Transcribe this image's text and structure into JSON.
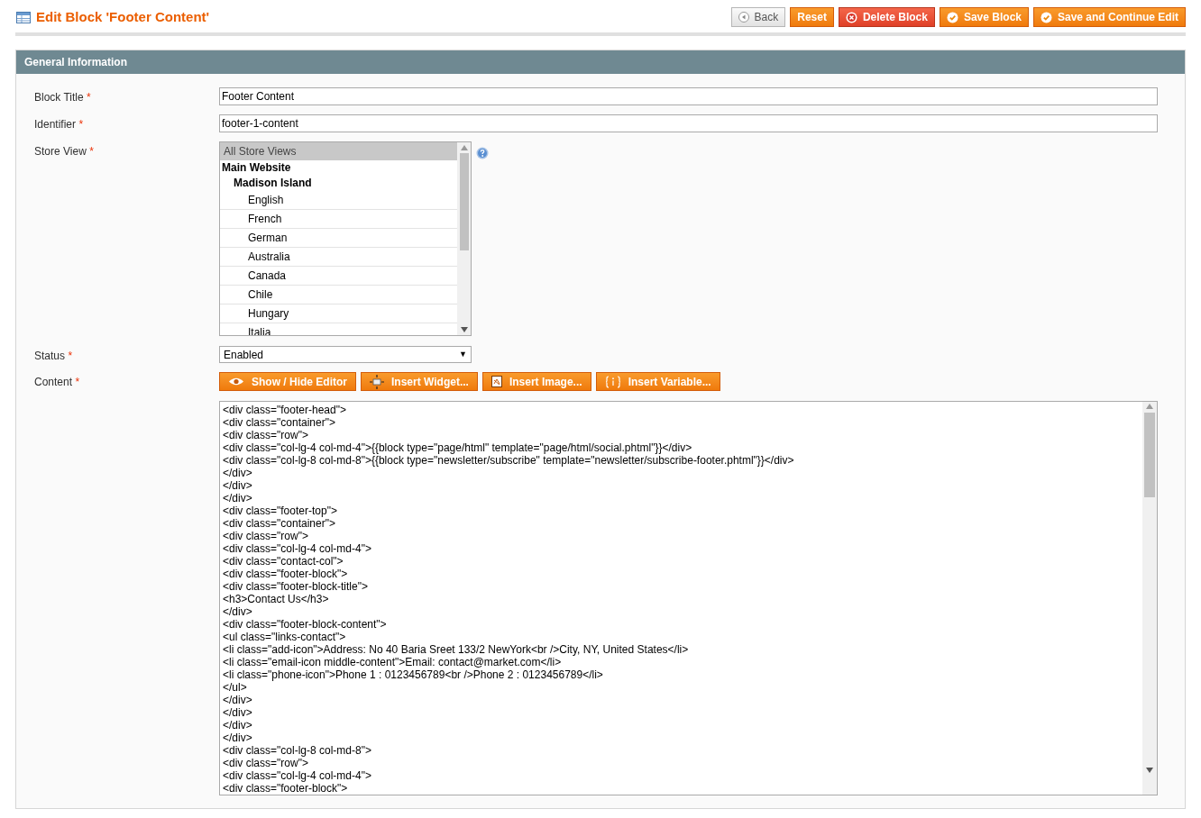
{
  "page_title": "Edit Block 'Footer Content'",
  "header_buttons": [
    {
      "label": "Back",
      "kind": "back"
    },
    {
      "label": "Reset",
      "kind": "plain"
    },
    {
      "label": "Delete Block",
      "kind": "delete"
    },
    {
      "label": "Save Block",
      "kind": "save"
    },
    {
      "label": "Save and Continue Edit",
      "kind": "save"
    }
  ],
  "section_title": "General Information",
  "required_mark": "*",
  "block_title": {
    "label": "Block Title",
    "value": "Footer Content"
  },
  "identifier": {
    "label": "Identifier",
    "value": "footer-1-content"
  },
  "store_view": {
    "label": "Store View",
    "options": [
      {
        "label": "All Store Views",
        "selected": true
      },
      {
        "label": "Main Website",
        "children": [
          {
            "label": "Madison Island",
            "children": [
              {
                "label": "English",
                "selected": false
              },
              {
                "label": "French",
                "selected": false
              },
              {
                "label": "German",
                "selected": false
              },
              {
                "label": "Australia",
                "selected": false
              },
              {
                "label": "Canada",
                "selected": false
              },
              {
                "label": "Chile",
                "selected": false
              },
              {
                "label": "Hungary",
                "selected": false
              },
              {
                "label": "Italia",
                "selected": false
              }
            ]
          }
        ]
      }
    ]
  },
  "status": {
    "label": "Status",
    "value": "Enabled",
    "caret": "▼"
  },
  "content": {
    "label": "Content",
    "buttons": [
      {
        "label": "Show / Hide Editor",
        "kind": "eye"
      },
      {
        "label": "Insert Widget...",
        "kind": "widget"
      },
      {
        "label": "Insert Image...",
        "kind": "image"
      },
      {
        "label": "Insert Variable...",
        "kind": "variable"
      }
    ],
    "lines": [
      "<div class=\"footer-head\">",
      "<div class=\"container\">",
      "<div class=\"row\">",
      "<div class=\"col-lg-4 col-md-4\">{{block type=\"page/html\" template=\"page/html/social.phtml\"}}</div>",
      "<div class=\"col-lg-8 col-md-8\">{{block type=\"newsletter/subscribe\" template=\"newsletter/subscribe-footer.phtml\"}}</div>",
      "</div>",
      "</div>",
      "</div>",
      "<div class=\"footer-top\">",
      "<div class=\"container\">",
      "<div class=\"row\">",
      "<div class=\"col-lg-4 col-md-4\">",
      "<div class=\"contact-col\">",
      "<div class=\"footer-block\">",
      "<div class=\"footer-block-title\">",
      "<h3>Contact Us</h3>",
      "</div>",
      "<div class=\"footer-block-content\">",
      "<ul class=\"links-contact\">",
      "<li class=\"add-icon\">Address: No 40 Baria Sreet 133/2 NewYork<br />City, NY, United States</li>",
      "<li class=\"email-icon middle-content\">Email: contact@market.com</li>",
      "<li class=\"phone-icon\">Phone 1 : 0123456789<br />Phone 2 : 0123456789</li>",
      "</ul>",
      "</div>",
      "</div>",
      "</div>",
      "</div>",
      "<div class=\"col-lg-8 col-md-8\">",
      "<div class=\"row\">",
      "<div class=\"col-lg-4 col-md-4\">",
      "<div class=\"footer-block\">"
    ]
  }
}
